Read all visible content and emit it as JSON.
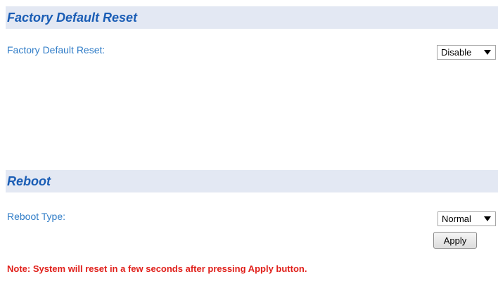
{
  "factory_reset": {
    "title": "Factory Default Reset",
    "field_label": "Factory Default Reset:",
    "select_value": "Disable"
  },
  "reboot": {
    "title": "Reboot",
    "field_label": "Reboot Type:",
    "select_value": "Normal",
    "apply_label": "Apply"
  },
  "note": "Note: System will reset in a few seconds after pressing Apply button.",
  "colors": {
    "header_background": "#e3e8f3",
    "title_text": "#1a5db5",
    "label_text": "#2f7cc7",
    "note_text": "#e0201b"
  }
}
